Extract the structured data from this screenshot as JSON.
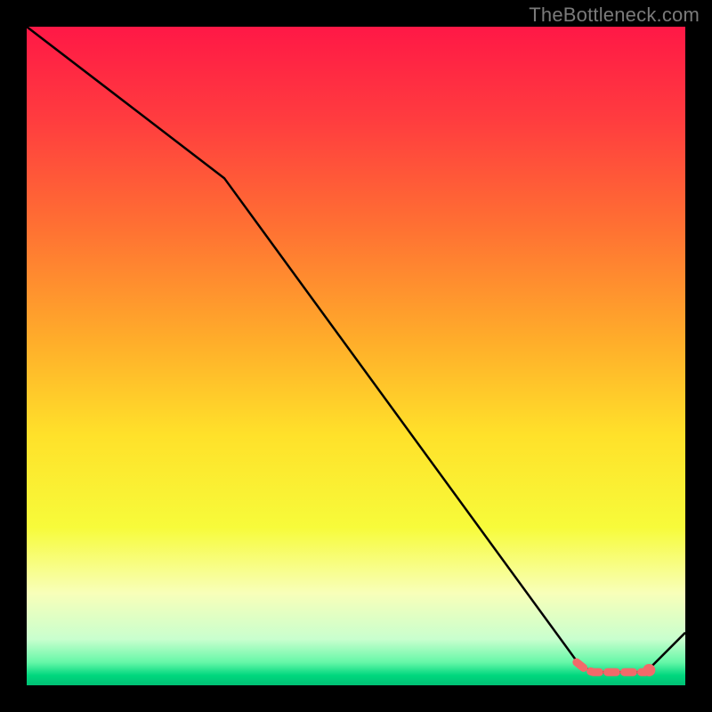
{
  "watermark": "TheBottleneck.com",
  "chart_data": {
    "type": "line",
    "title": "",
    "xlabel": "",
    "ylabel": "",
    "xlim": [
      0,
      100
    ],
    "ylim": [
      0,
      100
    ],
    "grid": false,
    "series": [
      {
        "name": "bottleneck-curve",
        "color": "#000000",
        "x": [
          0,
          30,
          84,
          86,
          94,
          100
        ],
        "y": [
          100,
          77,
          3,
          2,
          2,
          8
        ]
      }
    ],
    "highlight_segments": [
      {
        "name": "bottleneck-optimal-range",
        "color": "#F26A6A",
        "style": "dashed",
        "points_xy": [
          [
            83.5,
            3.5
          ],
          [
            85,
            2.3
          ],
          [
            86,
            2
          ],
          [
            88,
            2
          ],
          [
            90,
            2
          ],
          [
            92,
            2
          ],
          [
            94,
            2
          ],
          [
            94.5,
            2.3
          ]
        ],
        "end_marker_xy": [
          94.5,
          2.3
        ]
      }
    ],
    "background_gradient": {
      "type": "vertical",
      "stops": [
        {
          "pos": 0.0,
          "color": "#ff1846"
        },
        {
          "pos": 0.14,
          "color": "#ff3c3f"
        },
        {
          "pos": 0.3,
          "color": "#ff6f33"
        },
        {
          "pos": 0.48,
          "color": "#ffae2a"
        },
        {
          "pos": 0.62,
          "color": "#ffe12a"
        },
        {
          "pos": 0.76,
          "color": "#f7fb3a"
        },
        {
          "pos": 0.86,
          "color": "#f8ffb9"
        },
        {
          "pos": 0.93,
          "color": "#c9ffce"
        },
        {
          "pos": 0.965,
          "color": "#66f7a8"
        },
        {
          "pos": 0.985,
          "color": "#00d77e"
        },
        {
          "pos": 1.0,
          "color": "#00c074"
        }
      ]
    }
  }
}
